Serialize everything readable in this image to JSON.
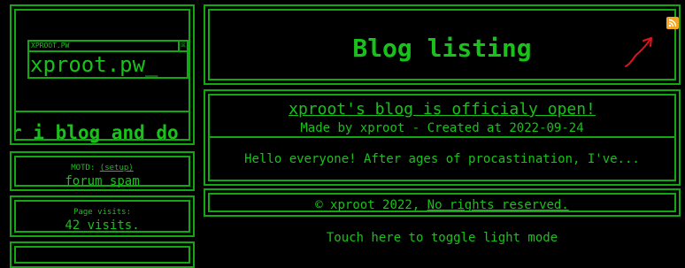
{
  "sidebar": {
    "logo": {
      "window_title": "XPROOT.PW",
      "close_glyph": "☒",
      "text": "xproot.pw_"
    },
    "marquee_text": "r i blog and do",
    "motd": {
      "label_prefix": "MOTD: ",
      "setup_link": "(setup)",
      "value": "forum spam"
    },
    "visits": {
      "label": "Page visits:",
      "value": "42 visits."
    }
  },
  "header": {
    "title": "Blog listing",
    "rss_icon": "rss-feed-icon",
    "annotation_icon": "red-arrow-icon"
  },
  "posts": [
    {
      "title": "xproot's blog is officialy open!",
      "meta": "Made by xproot - Created at 2022-09-24",
      "excerpt": "Hello everyone! After ages of procastination, I've..."
    }
  ],
  "footer": {
    "copyright": "© xproot 2022, ",
    "rights_link": "No rights reserved."
  },
  "toggle": {
    "label": "Touch here to toggle light mode"
  },
  "colors": {
    "background": "#000000",
    "accent": "#18c21a",
    "border": "#11a811",
    "rss": "#f5a623",
    "annotation": "#e0141c"
  }
}
